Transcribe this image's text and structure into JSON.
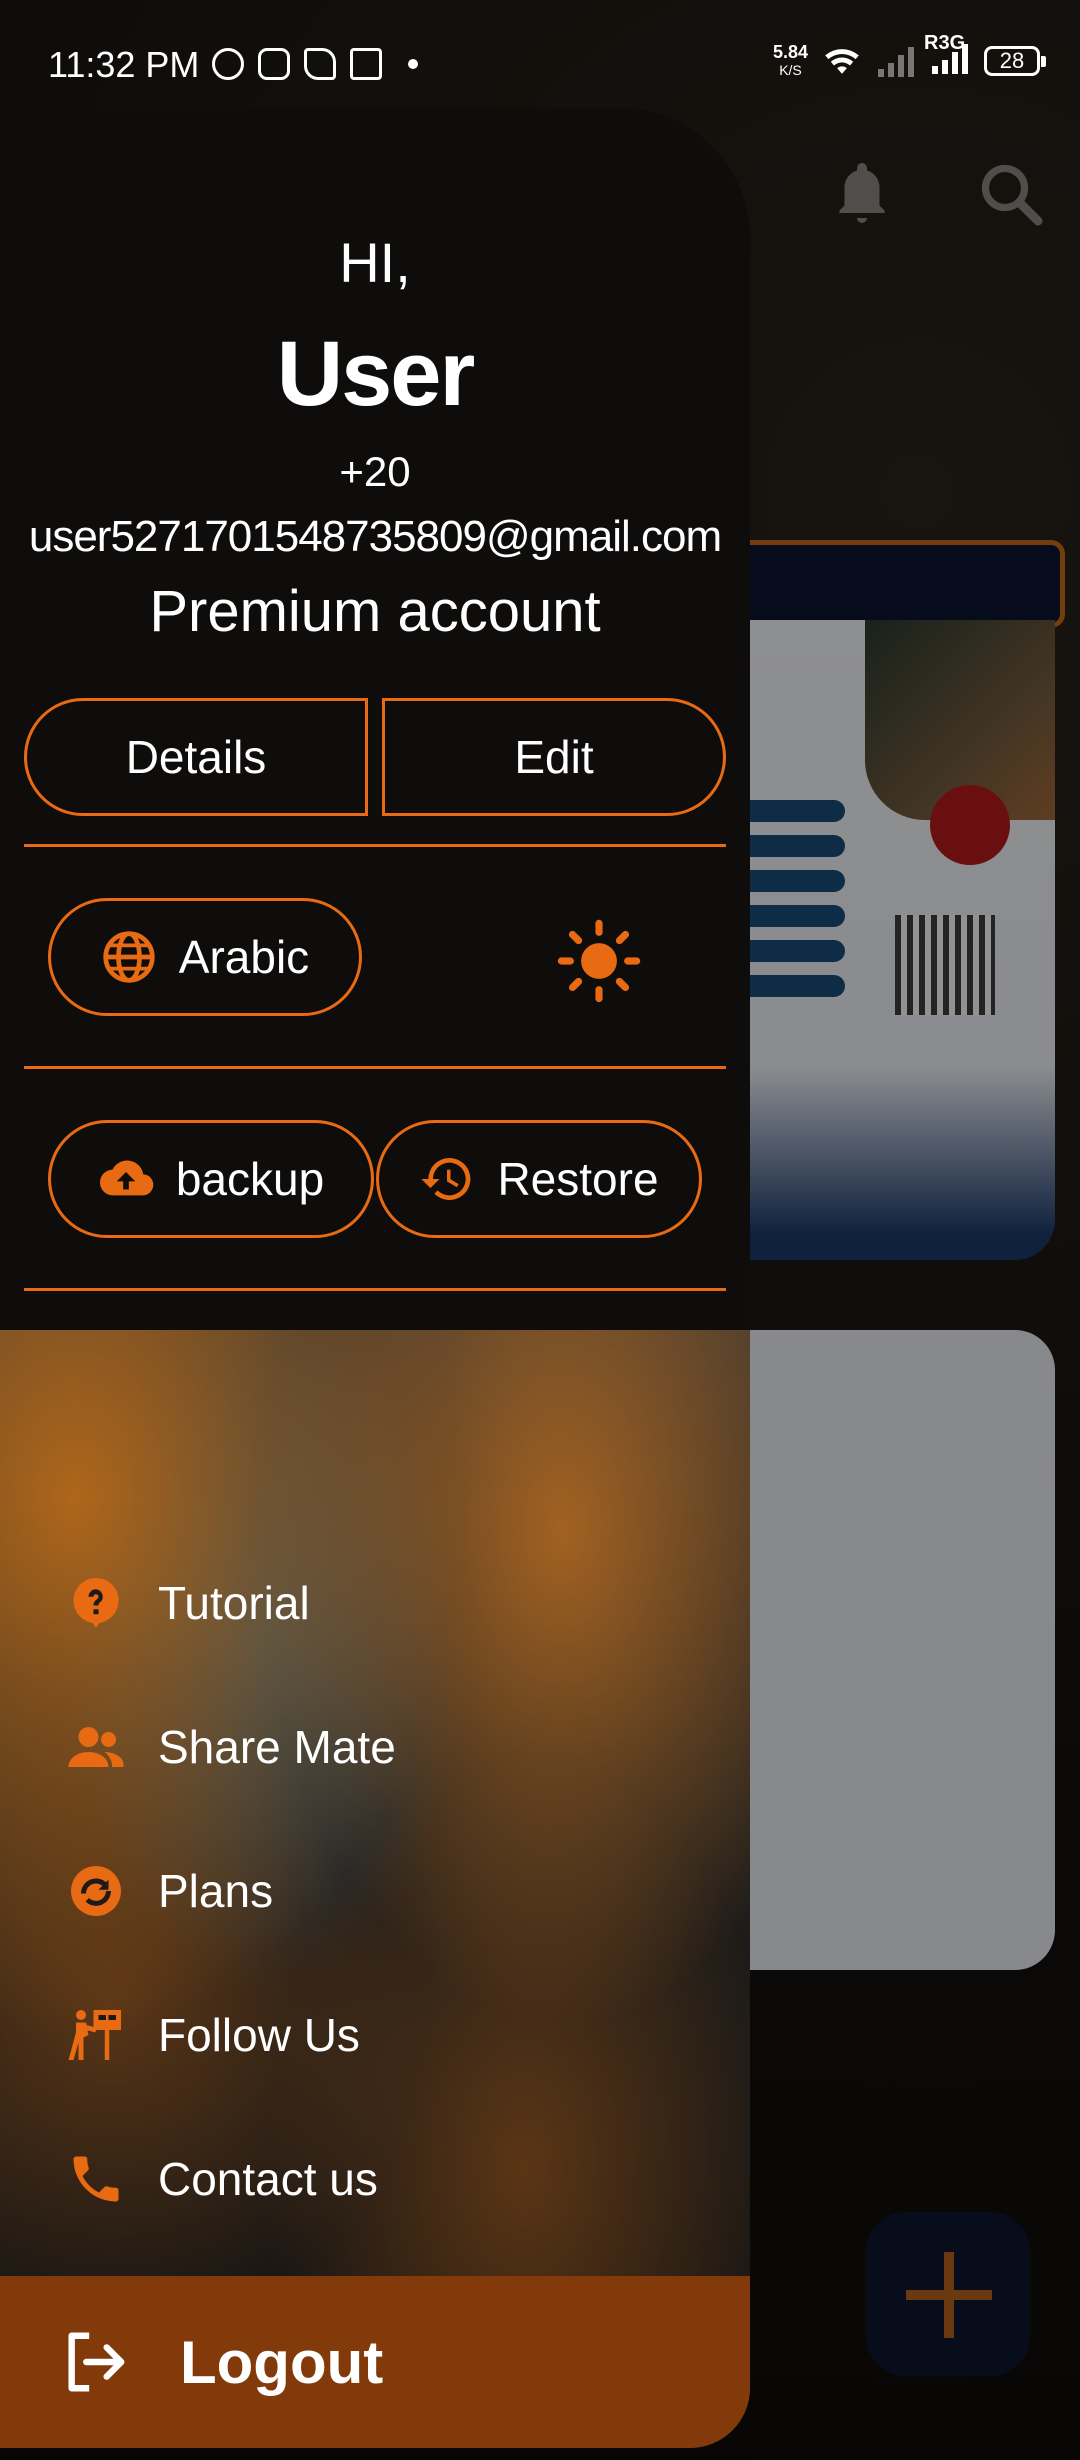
{
  "status_bar": {
    "time": "11:32 PM",
    "net_speed_value": "5.84",
    "net_speed_unit": "K/S",
    "carrier": "R3G",
    "battery": "28"
  },
  "profile": {
    "greeting": "HI,",
    "name": "User",
    "phone": "+20",
    "email": "user5271701548735809@gmail.com",
    "account_type": "Premium account"
  },
  "actions": {
    "details_label": "Details",
    "edit_label": "Edit",
    "language_label": "Arabic",
    "backup_label": "backup",
    "restore_label": "Restore"
  },
  "menu": {
    "items": [
      {
        "label": "Tutorial",
        "icon": "help-circle-icon"
      },
      {
        "label": "Share Mate",
        "icon": "people-icon"
      },
      {
        "label": "Plans",
        "icon": "plans-icon"
      },
      {
        "label": "Follow Us",
        "icon": "follow-icon"
      },
      {
        "label": "Contact us",
        "icon": "phone-icon"
      }
    ]
  },
  "logout": {
    "label": "Logout"
  },
  "colors": {
    "accent": "#e86a12",
    "logout_bg": "#833a0a",
    "drawer_bg": "#0f0d0b"
  }
}
